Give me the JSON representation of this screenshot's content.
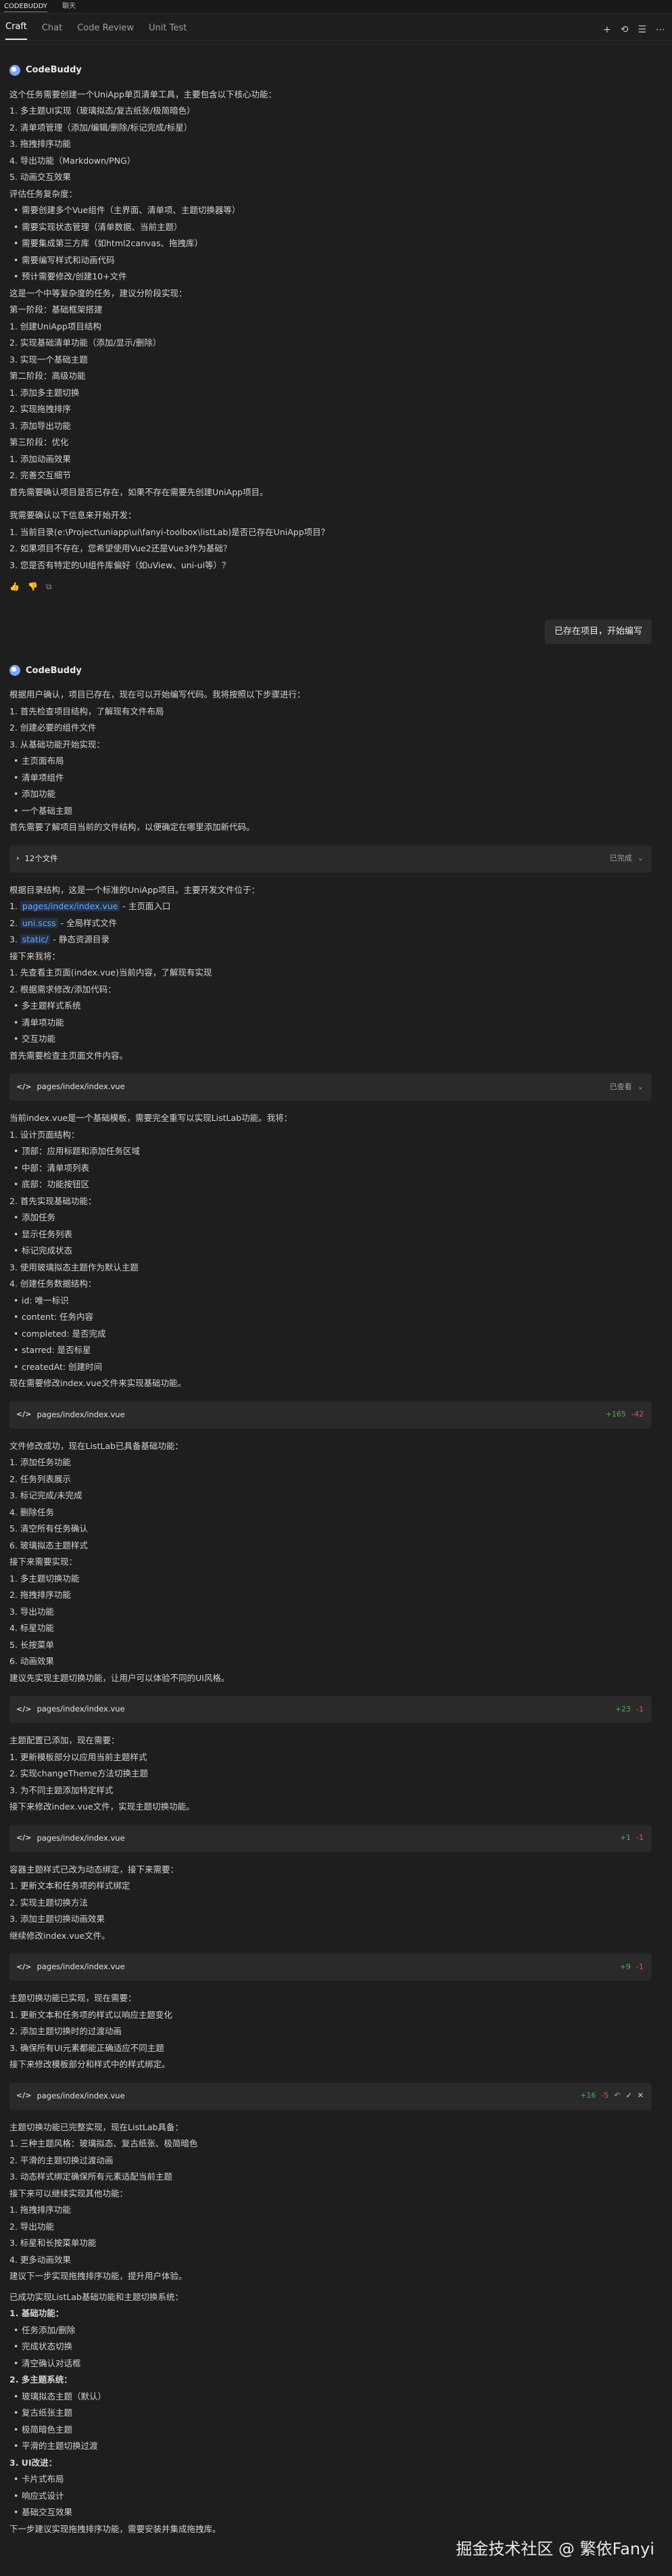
{
  "titlebar": {
    "items": [
      "CODEBUDDY",
      "聊天"
    ]
  },
  "tabs": [
    "Craft",
    "Chat",
    "Code Review",
    "Unit Test"
  ],
  "tab_tools": [
    "+",
    "⟲",
    "☰",
    "⋯"
  ],
  "assistant_name": "CodeBuddy",
  "msg1": [
    "这个任务需要创建一个UniApp单页清单工具，主要包含以下核心功能：",
    "1. 多主题UI实现（玻璃拟态/复古纸张/极简暗色）",
    "2. 清单项管理（添加/编辑/删除/标记完成/标星）",
    "3. 拖拽排序功能",
    "4. 导出功能（Markdown/PNG）",
    "5. 动画交互效果",
    "评估任务复杂度：",
    "需要创建多个Vue组件（主界面、清单项、主题切换器等）",
    "需要实现状态管理（清单数据、当前主题）",
    "需要集成第三方库（如html2canvas、拖拽库）",
    "需要编写样式和动画代码",
    "预计需要修改/创建10+文件",
    "这是一个中等复杂度的任务，建议分阶段实现：",
    "第一阶段：基础框架搭建",
    "1. 创建UniApp项目结构",
    "2. 实现基础清单功能（添加/显示/删除）",
    "3. 实现一个基础主题",
    "第二阶段：高级功能",
    "1. 添加多主题切换",
    "2. 实现拖拽排序",
    "3. 添加导出功能",
    "第三阶段：优化",
    "1. 添加动画效果",
    "2. 完善交互细节",
    "首先需要确认项目是否已存在，如果不存在需要先创建UniApp项目。",
    "我需要确认以下信息来开始开发：",
    "1. 当前目录(e:\\Project\\uniapp\\ui\\fanyi-toolbox\\listLab)是否已存在UniApp项目？",
    "2. 如果项目不存在，您希望使用Vue2还是Vue3作为基础？",
    "3. 您是否有特定的UI组件库偏好（如uView、uni-ui等）？"
  ],
  "feedback": [
    "👍",
    "👎",
    "⧉"
  ],
  "user_msg": "已存在项目，开始编写",
  "msg2": [
    "根据用户确认，项目已存在，现在可以开始编写代码。我将按照以下步骤进行：",
    "1. 首先检查项目结构，了解现有文件布局",
    "2. 创建必要的组件文件",
    "3. 从基础功能开始实现：",
    "主页面布局",
    "清单项组件",
    "添加功能",
    "一个基础主题",
    "首先需要了解项目当前的文件结构，以便确定在哪里添加新代码。"
  ],
  "block1": {
    "label": "12个文件",
    "status": "已完成"
  },
  "msg3": [
    "根据目录结构，这是一个标准的UniApp项目。主要开发文件位于：",
    "pages/index/index.vue",
    " - 主页面入口",
    "uni.scss",
    " - 全局样式文件",
    "static/",
    " - 静态资源目录",
    "接下来我将：",
    "1. 先查看主页面(index.vue)当前内容，了解现有实现",
    "2. 根据需求修改/添加代码：",
    "多主题样式系统",
    "清单项功能",
    "交互功能",
    "首先需要检查主页面文件内容。"
  ],
  "block2": {
    "label": "pages/index/index.vue",
    "status": "已查看"
  },
  "msg4": [
    "当前index.vue是一个基础模板，需要完全重写以实现ListLab功能。我将：",
    "1. 设计页面结构：",
    "顶部：应用标题和添加任务区域",
    "中部：清单项列表",
    "底部：功能按钮区",
    "2. 首先实现基础功能：",
    "添加任务",
    "显示任务列表",
    "标记完成状态",
    "3. 使用玻璃拟态主题作为默认主题",
    "4. 创建任务数据结构：",
    "id: 唯一标识",
    "content: 任务内容",
    "completed: 是否完成",
    "starred: 是否标星",
    "createdAt: 创建时间",
    "现在需要修改index.vue文件来实现基础功能。"
  ],
  "block3": {
    "label": "pages/index/index.vue",
    "added": "+165",
    "removed": "-42"
  },
  "msg5": [
    "文件修改成功，现在ListLab已具备基础功能：",
    "1. 添加任务功能",
    "2. 任务列表展示",
    "3. 标记完成/未完成",
    "4. 删除任务",
    "5. 清空所有任务确认",
    "6. 玻璃拟态主题样式",
    "接下来需要实现：",
    "1. 多主题切换功能",
    "2. 拖拽排序功能",
    "3. 导出功能",
    "4. 标星功能",
    "5. 长按菜单",
    "6. 动画效果",
    "建议先实现主题切换功能，让用户可以体验不同的UI风格。"
  ],
  "block4": {
    "label": "pages/index/index.vue",
    "added": "+23",
    "removed": "-1"
  },
  "msg6": [
    "主题配置已添加，现在需要：",
    "1. 更新模板部分以应用当前主题样式",
    "2. 实现changeTheme方法切换主题",
    "3. 为不同主题添加特定样式",
    "接下来修改index.vue文件，实现主题切换功能。"
  ],
  "block5": {
    "label": "pages/index/index.vue",
    "added": "+1",
    "removed": "-1"
  },
  "msg7": [
    "容器主题样式已改为动态绑定，接下来需要：",
    "1. 更新文本和任务项的样式绑定",
    "2. 实现主题切换方法",
    "3. 添加主题切换动画效果",
    "继续修改index.vue文件。"
  ],
  "block6": {
    "label": "pages/index/index.vue",
    "added": "+9",
    "removed": "-1"
  },
  "msg8": [
    "主题切换功能已实现，现在需要：",
    "1. 更新文本和任务项的样式以响应主题变化",
    "2. 添加主题切换时的过渡动画",
    "3. 确保所有UI元素都能正确适应不同主题",
    "接下来修改模板部分和样式中的样式绑定。"
  ],
  "block7": {
    "label": "pages/index/index.vue",
    "added": "+16",
    "removed": "-5"
  },
  "msg9": [
    "主题切换功能已完整实现，现在ListLab具备：",
    "1. 三种主题风格：玻璃拟态、复古纸张、极简暗色",
    "2. 平滑的主题切换过渡动画",
    "3. 动态样式绑定确保所有元素适配当前主题",
    "接下来可以继续实现其他功能：",
    "1. 拖拽排序功能",
    "2. 导出功能",
    "3. 标星和长按菜单功能",
    "4. 更多动画效果",
    "建议下一步实现拖拽排序功能，提升用户体验。",
    "已成功实现ListLab基础功能和主题切换系统：",
    "1. 基础功能：",
    "任务添加/删除",
    "完成状态切换",
    "清空确认对话框",
    "2. 多主题系统：",
    "玻璃拟态主题（默认）",
    "复古纸张主题",
    "极简暗色主题",
    "平滑的主题切换过渡",
    "3. UI改进：",
    "卡片式布局",
    "响应式设计",
    "基础交互效果",
    "下一步建议实现拖拽排序功能，需要安装并集成拖拽库。"
  ],
  "watermark": "掘金技术社区 @ 繁依Fanyi"
}
